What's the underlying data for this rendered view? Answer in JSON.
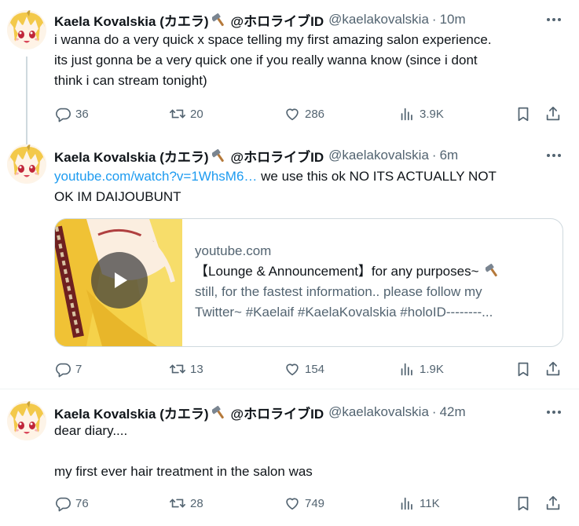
{
  "tweets": [
    {
      "display_name": "Kaela Kovalskia (カエラ)",
      "org": "@ホロライブID",
      "handle": "@kaelakovalskia",
      "separator": "·",
      "time": "10m",
      "text_lines": [
        "i wanna do a very quick x space telling my first amazing salon experience.",
        "its just gonna be a very quick one if you really wanna know (since i dont",
        "think i can stream tonight)"
      ],
      "replies": "36",
      "retweets": "20",
      "likes": "286",
      "views": "3.9K"
    },
    {
      "display_name": "Kaela Kovalskia (カエラ)",
      "org": "@ホロライブID",
      "handle": "@kaelakovalskia",
      "separator": "·",
      "time": "6m",
      "link_text": "youtube.com/watch?v=1WhsM6…",
      "text_after_link": " we use this ok NO ITS ACTUALLY NOT",
      "text_line2": "OK IM DAIJOUBUNT",
      "card": {
        "domain": "youtube.com",
        "title": "【Lounge & Announcement】for any purposes~ ",
        "desc_line1": "still, for the fastest information.. please follow my",
        "desc_line2": "Twitter~ #Kaelaif #KaelaKovalskia #holoID--------..."
      },
      "replies": "7",
      "retweets": "13",
      "likes": "154",
      "views": "1.9K"
    },
    {
      "display_name": "Kaela Kovalskia (カエラ)",
      "org": "@ホロライブID",
      "handle": "@kaelakovalskia",
      "separator": "·",
      "time": "42m",
      "line1": "dear diary....",
      "line2": "my first ever hair treatment in the salon was",
      "replies": "76",
      "retweets": "28",
      "likes": "749",
      "views": "11K"
    }
  ],
  "icons": {
    "avatar": "kaela-avatar",
    "hammer": "hammer-icon",
    "more": "more-icon",
    "reply": "reply-icon",
    "retweet": "retweet-icon",
    "like": "like-icon",
    "views": "views-icon",
    "bookmark": "bookmark-icon",
    "share": "share-icon",
    "play": "play-icon"
  },
  "colors": {
    "text": "#0f1419",
    "secondary": "#536471",
    "link": "#1d9bf0",
    "border": "#cfd9de"
  }
}
